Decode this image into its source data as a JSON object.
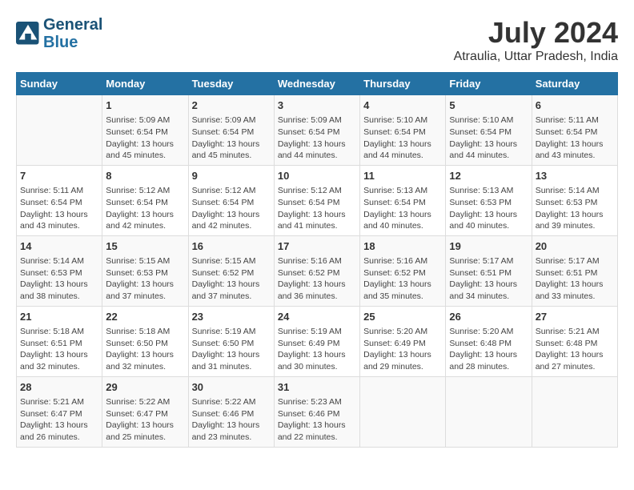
{
  "header": {
    "logo_line1": "General",
    "logo_line2": "Blue",
    "title": "July 2024",
    "subtitle": "Atraulia, Uttar Pradesh, India"
  },
  "days_of_week": [
    "Sunday",
    "Monday",
    "Tuesday",
    "Wednesday",
    "Thursday",
    "Friday",
    "Saturday"
  ],
  "weeks": [
    [
      {
        "day": "",
        "content": ""
      },
      {
        "day": "1",
        "content": "Sunrise: 5:09 AM\nSunset: 6:54 PM\nDaylight: 13 hours\nand 45 minutes."
      },
      {
        "day": "2",
        "content": "Sunrise: 5:09 AM\nSunset: 6:54 PM\nDaylight: 13 hours\nand 45 minutes."
      },
      {
        "day": "3",
        "content": "Sunrise: 5:09 AM\nSunset: 6:54 PM\nDaylight: 13 hours\nand 44 minutes."
      },
      {
        "day": "4",
        "content": "Sunrise: 5:10 AM\nSunset: 6:54 PM\nDaylight: 13 hours\nand 44 minutes."
      },
      {
        "day": "5",
        "content": "Sunrise: 5:10 AM\nSunset: 6:54 PM\nDaylight: 13 hours\nand 44 minutes."
      },
      {
        "day": "6",
        "content": "Sunrise: 5:11 AM\nSunset: 6:54 PM\nDaylight: 13 hours\nand 43 minutes."
      }
    ],
    [
      {
        "day": "7",
        "content": "Sunrise: 5:11 AM\nSunset: 6:54 PM\nDaylight: 13 hours\nand 43 minutes."
      },
      {
        "day": "8",
        "content": "Sunrise: 5:12 AM\nSunset: 6:54 PM\nDaylight: 13 hours\nand 42 minutes."
      },
      {
        "day": "9",
        "content": "Sunrise: 5:12 AM\nSunset: 6:54 PM\nDaylight: 13 hours\nand 42 minutes."
      },
      {
        "day": "10",
        "content": "Sunrise: 5:12 AM\nSunset: 6:54 PM\nDaylight: 13 hours\nand 41 minutes."
      },
      {
        "day": "11",
        "content": "Sunrise: 5:13 AM\nSunset: 6:54 PM\nDaylight: 13 hours\nand 40 minutes."
      },
      {
        "day": "12",
        "content": "Sunrise: 5:13 AM\nSunset: 6:53 PM\nDaylight: 13 hours\nand 40 minutes."
      },
      {
        "day": "13",
        "content": "Sunrise: 5:14 AM\nSunset: 6:53 PM\nDaylight: 13 hours\nand 39 minutes."
      }
    ],
    [
      {
        "day": "14",
        "content": "Sunrise: 5:14 AM\nSunset: 6:53 PM\nDaylight: 13 hours\nand 38 minutes."
      },
      {
        "day": "15",
        "content": "Sunrise: 5:15 AM\nSunset: 6:53 PM\nDaylight: 13 hours\nand 37 minutes."
      },
      {
        "day": "16",
        "content": "Sunrise: 5:15 AM\nSunset: 6:52 PM\nDaylight: 13 hours\nand 37 minutes."
      },
      {
        "day": "17",
        "content": "Sunrise: 5:16 AM\nSunset: 6:52 PM\nDaylight: 13 hours\nand 36 minutes."
      },
      {
        "day": "18",
        "content": "Sunrise: 5:16 AM\nSunset: 6:52 PM\nDaylight: 13 hours\nand 35 minutes."
      },
      {
        "day": "19",
        "content": "Sunrise: 5:17 AM\nSunset: 6:51 PM\nDaylight: 13 hours\nand 34 minutes."
      },
      {
        "day": "20",
        "content": "Sunrise: 5:17 AM\nSunset: 6:51 PM\nDaylight: 13 hours\nand 33 minutes."
      }
    ],
    [
      {
        "day": "21",
        "content": "Sunrise: 5:18 AM\nSunset: 6:51 PM\nDaylight: 13 hours\nand 32 minutes."
      },
      {
        "day": "22",
        "content": "Sunrise: 5:18 AM\nSunset: 6:50 PM\nDaylight: 13 hours\nand 32 minutes."
      },
      {
        "day": "23",
        "content": "Sunrise: 5:19 AM\nSunset: 6:50 PM\nDaylight: 13 hours\nand 31 minutes."
      },
      {
        "day": "24",
        "content": "Sunrise: 5:19 AM\nSunset: 6:49 PM\nDaylight: 13 hours\nand 30 minutes."
      },
      {
        "day": "25",
        "content": "Sunrise: 5:20 AM\nSunset: 6:49 PM\nDaylight: 13 hours\nand 29 minutes."
      },
      {
        "day": "26",
        "content": "Sunrise: 5:20 AM\nSunset: 6:48 PM\nDaylight: 13 hours\nand 28 minutes."
      },
      {
        "day": "27",
        "content": "Sunrise: 5:21 AM\nSunset: 6:48 PM\nDaylight: 13 hours\nand 27 minutes."
      }
    ],
    [
      {
        "day": "28",
        "content": "Sunrise: 5:21 AM\nSunset: 6:47 PM\nDaylight: 13 hours\nand 26 minutes."
      },
      {
        "day": "29",
        "content": "Sunrise: 5:22 AM\nSunset: 6:47 PM\nDaylight: 13 hours\nand 25 minutes."
      },
      {
        "day": "30",
        "content": "Sunrise: 5:22 AM\nSunset: 6:46 PM\nDaylight: 13 hours\nand 23 minutes."
      },
      {
        "day": "31",
        "content": "Sunrise: 5:23 AM\nSunset: 6:46 PM\nDaylight: 13 hours\nand 22 minutes."
      },
      {
        "day": "",
        "content": ""
      },
      {
        "day": "",
        "content": ""
      },
      {
        "day": "",
        "content": ""
      }
    ]
  ]
}
